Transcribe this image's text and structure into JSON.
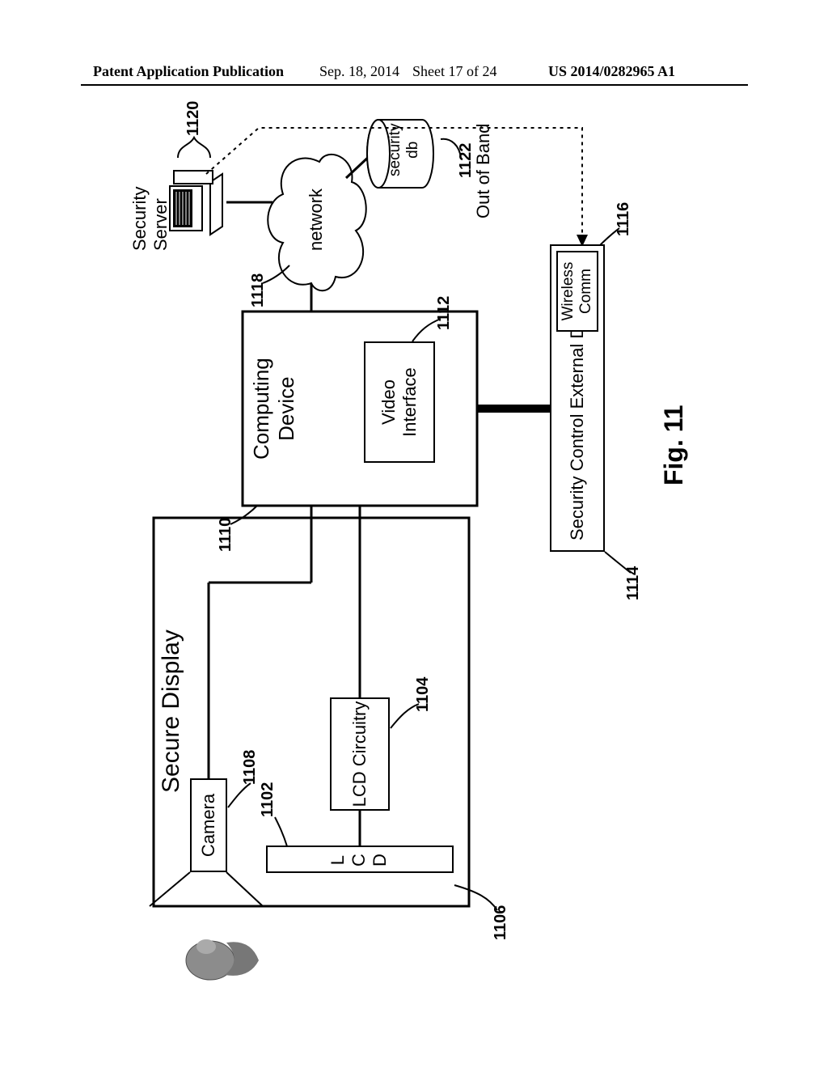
{
  "header": {
    "publication_label": "Patent Application Publication",
    "date": "Sep. 18, 2014",
    "sheet": "Sheet 17 of 24",
    "docnum": "US 2014/0282965 A1"
  },
  "figure_label": "Fig. 11",
  "labels": {
    "secure_display": "Secure Display",
    "camera": "Camera",
    "lcd": "L\nC\nD",
    "lcd_circuitry": "LCD\nCircuitry",
    "computing_device": "Computing\nDevice",
    "video_interface": "Video\nInterface",
    "security_control_external_device": "Security Control\nExternal Device",
    "wireless_comm": "Wireless\nComm",
    "network": "network",
    "security_server": "Security\nServer",
    "security_db": "security\ndb",
    "out_of_band": "Out of Band"
  },
  "refs": {
    "r1102": "1102",
    "r1104": "1104",
    "r1106": "1106",
    "r1108": "1108",
    "r1110": "1110",
    "r1112": "1112",
    "r1114": "1114",
    "r1116": "1116",
    "r1118": "1118",
    "r1120": "1120",
    "r1122": "1122"
  }
}
